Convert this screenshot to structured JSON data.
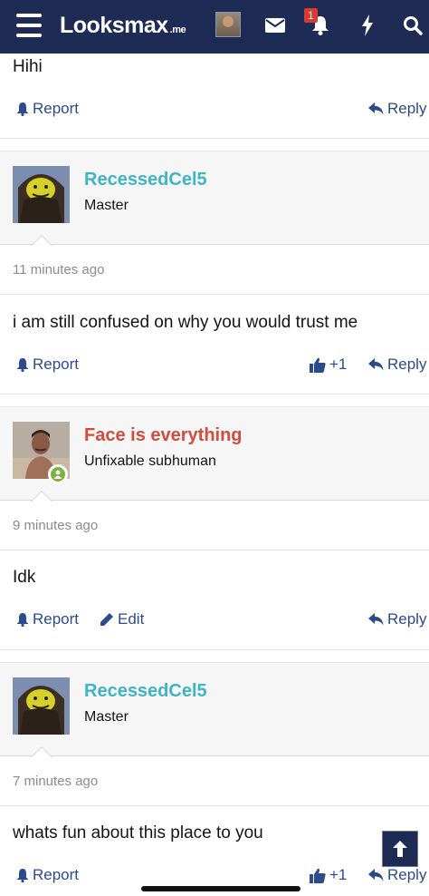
{
  "header": {
    "logo_main": "Looksmax",
    "logo_tld": ".me",
    "alert_badge": "1"
  },
  "icons": {
    "menu": "hamburger-icon",
    "messages": "envelope-icon",
    "alerts": "bell-icon",
    "whats_new": "bolt-icon",
    "search": "search-icon"
  },
  "colors": {
    "header_bg": "#1d2b55",
    "link": "#2c4b8d",
    "username_teal": "#3fb4c5",
    "username_red": "#d24c3e",
    "online": "#7cb342"
  },
  "actions": {
    "report": "Report",
    "reply": "Reply",
    "edit": "Edit",
    "like": "+1"
  },
  "posts": [
    {
      "message": "Hihi"
    },
    {
      "username": "RecessedCel5",
      "user_title": "Master",
      "time": "11 minutes ago",
      "message": "i am still confused on why you would trust me"
    },
    {
      "username": "Face is everything",
      "user_title": "Unfixable subhuman",
      "time": "9 minutes ago",
      "message": "Idk"
    },
    {
      "username": "RecessedCel5",
      "user_title": "Master",
      "time": "7 minutes ago",
      "message": "whats fun about this place to you"
    }
  ]
}
